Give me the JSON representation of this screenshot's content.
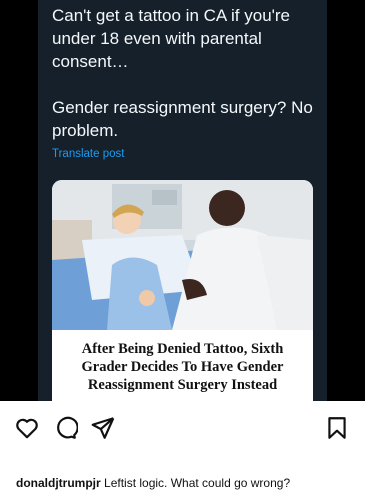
{
  "post": {
    "text": "Can't get a tattoo in CA if you're under 18 even with parental consent…\n\nGender reassignment surgery? No problem.",
    "translate_label": "Translate post",
    "article_headline": "After Being Denied Tattoo, Sixth Grader Decides To Have Gender Reassignment Surgery Instead"
  },
  "actions": {
    "icons": [
      "heart-icon",
      "comment-icon",
      "share-icon",
      "bookmark-icon"
    ]
  },
  "caption": {
    "username": "donaldjtrumpjr",
    "text": "Leftist logic. What could go wrong?"
  }
}
